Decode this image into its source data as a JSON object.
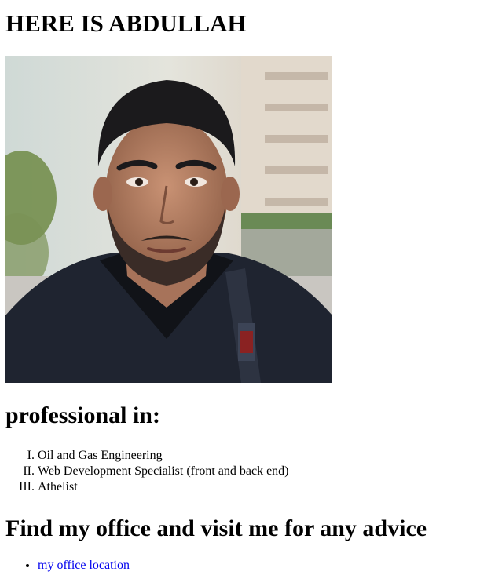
{
  "header": {
    "title": "HERE IS ABDULLAH"
  },
  "photo": {
    "subject": "portrait-photo",
    "colors": {
      "sky": "#dfe6e8",
      "building": "#d8cfc4",
      "foliage": "#5c7a3a",
      "jacket": "#1f2430",
      "skin": "#b98466",
      "hair": "#1b1a1c"
    }
  },
  "professional": {
    "heading": "professional in:",
    "items": [
      "Oil and Gas Engineering",
      "Web Development Specialist (front and back end)",
      "Athelist"
    ]
  },
  "office": {
    "heading": "Find my office and visit me for any advice",
    "links": [
      "my office location"
    ]
  },
  "colors": {
    "link": "#0000ee",
    "text": "#000000",
    "background": "#ffffff"
  }
}
